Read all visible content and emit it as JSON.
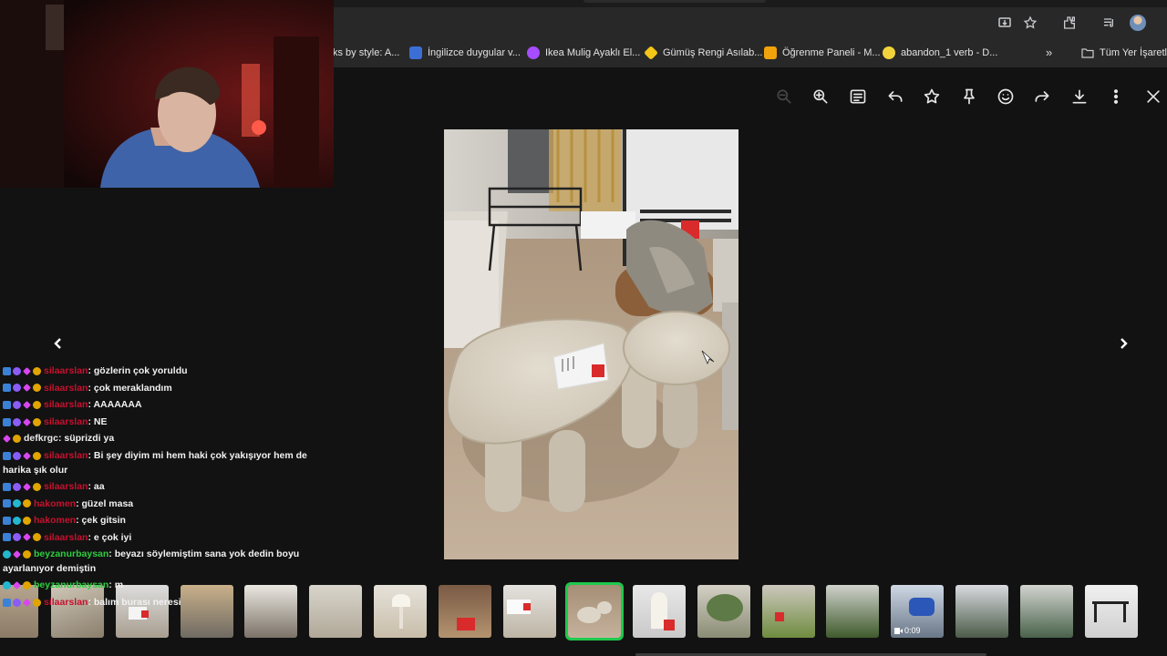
{
  "browser": {
    "bookmarks": [
      {
        "label": "ks by style: A...",
        "icon": "pinterest-favicon",
        "color": "#e60023"
      },
      {
        "label": "İngilizce duygular v...",
        "icon": "flag-favicon",
        "color": "#3c6fd6"
      },
      {
        "label": "Ikea Mulig Ayaklı El...",
        "icon": "purple-favicon",
        "color": "#a64dff"
      },
      {
        "label": "Gümüş Rengi Asılab...",
        "icon": "tag-favicon",
        "color": "#f5c518"
      },
      {
        "label": "Öğrenme Paneli - M...",
        "icon": "moodle-favicon",
        "color": "#f0a30a"
      },
      {
        "label": "abandon_1 verb - D...",
        "icon": "dictionary-favicon",
        "color": "#f2d33b"
      }
    ],
    "bookmarks_more": "»",
    "all_bookmarks": "Tüm Yer İşaretle"
  },
  "viewer": {
    "toolbar_icons": [
      "zoom-in-icon",
      "details-icon",
      "reply-icon",
      "star-icon",
      "pin-icon",
      "emoji-icon",
      "forward-icon",
      "download-icon",
      "more-icon",
      "close-icon"
    ],
    "selected_thumbnail_index": 8,
    "video_duration": "0:09",
    "thumbnail_count": 18
  },
  "chat": {
    "messages": [
      {
        "user": "silaarslan",
        "user_color": "red",
        "badges": [
          "b-blue",
          "b-purple",
          "b-pink",
          "b-gold"
        ],
        "text": ": gözlerin çok yoruldu"
      },
      {
        "user": "silaarslan",
        "user_color": "red",
        "badges": [
          "b-blue",
          "b-purple",
          "b-pink",
          "b-gold"
        ],
        "text": ": çok meraklandım"
      },
      {
        "user": "silaarslan",
        "user_color": "red",
        "badges": [
          "b-blue",
          "b-purple",
          "b-pink",
          "b-gold"
        ],
        "text": ": AAAAAAA"
      },
      {
        "user": "silaarslan",
        "user_color": "red",
        "badges": [
          "b-blue",
          "b-purple",
          "b-pink",
          "b-gold"
        ],
        "text": ": NE"
      },
      {
        "user": "defkrgc",
        "user_color": "white",
        "badges": [
          "b-pink",
          "b-gold"
        ],
        "text": ": süprizdi ya"
      },
      {
        "user": "silaarslan",
        "user_color": "red",
        "badges": [
          "b-blue",
          "b-purple",
          "b-pink",
          "b-gold"
        ],
        "text": ": Bi şey diyim mi hem haki çok yakışıyor hem de harika şık olur",
        "wrap": true
      },
      {
        "user": "silaarslan",
        "user_color": "red",
        "badges": [
          "b-blue",
          "b-purple",
          "b-pink",
          "b-gold"
        ],
        "text": ": aa"
      },
      {
        "user": "hakomen",
        "user_color": "red",
        "badges": [
          "b-blue",
          "b-cyan",
          "b-gold"
        ],
        "text": ": güzel masa"
      },
      {
        "user": "hakomen",
        "user_color": "red",
        "badges": [
          "b-blue",
          "b-cyan",
          "b-gold"
        ],
        "text": ": çek gitsin"
      },
      {
        "user": "silaarslan",
        "user_color": "red",
        "badges": [
          "b-blue",
          "b-purple",
          "b-pink",
          "b-gold"
        ],
        "text": ": e çok iyi"
      },
      {
        "user": "beyzanurbaysan",
        "user_color": "green",
        "badges": [
          "b-cyan",
          "b-pink",
          "b-gold"
        ],
        "text": ": beyazı söylemiştim sana yok dedin boyu ayarlanıyor demiştin",
        "wrap": true
      },
      {
        "user": "beyzanurbaysan",
        "user_color": "green",
        "badges": [
          "b-cyan",
          "b-pink",
          "b-gold"
        ],
        "text": ": m"
      },
      {
        "user": "silaarslan",
        "user_color": "red",
        "badges": [
          "b-blue",
          "b-purple",
          "b-pink",
          "b-gold"
        ],
        "text": ": balım burası neresi"
      }
    ]
  },
  "colors": {
    "background": "#121212",
    "chrome": "#282828",
    "selection": "#1ec94c"
  }
}
